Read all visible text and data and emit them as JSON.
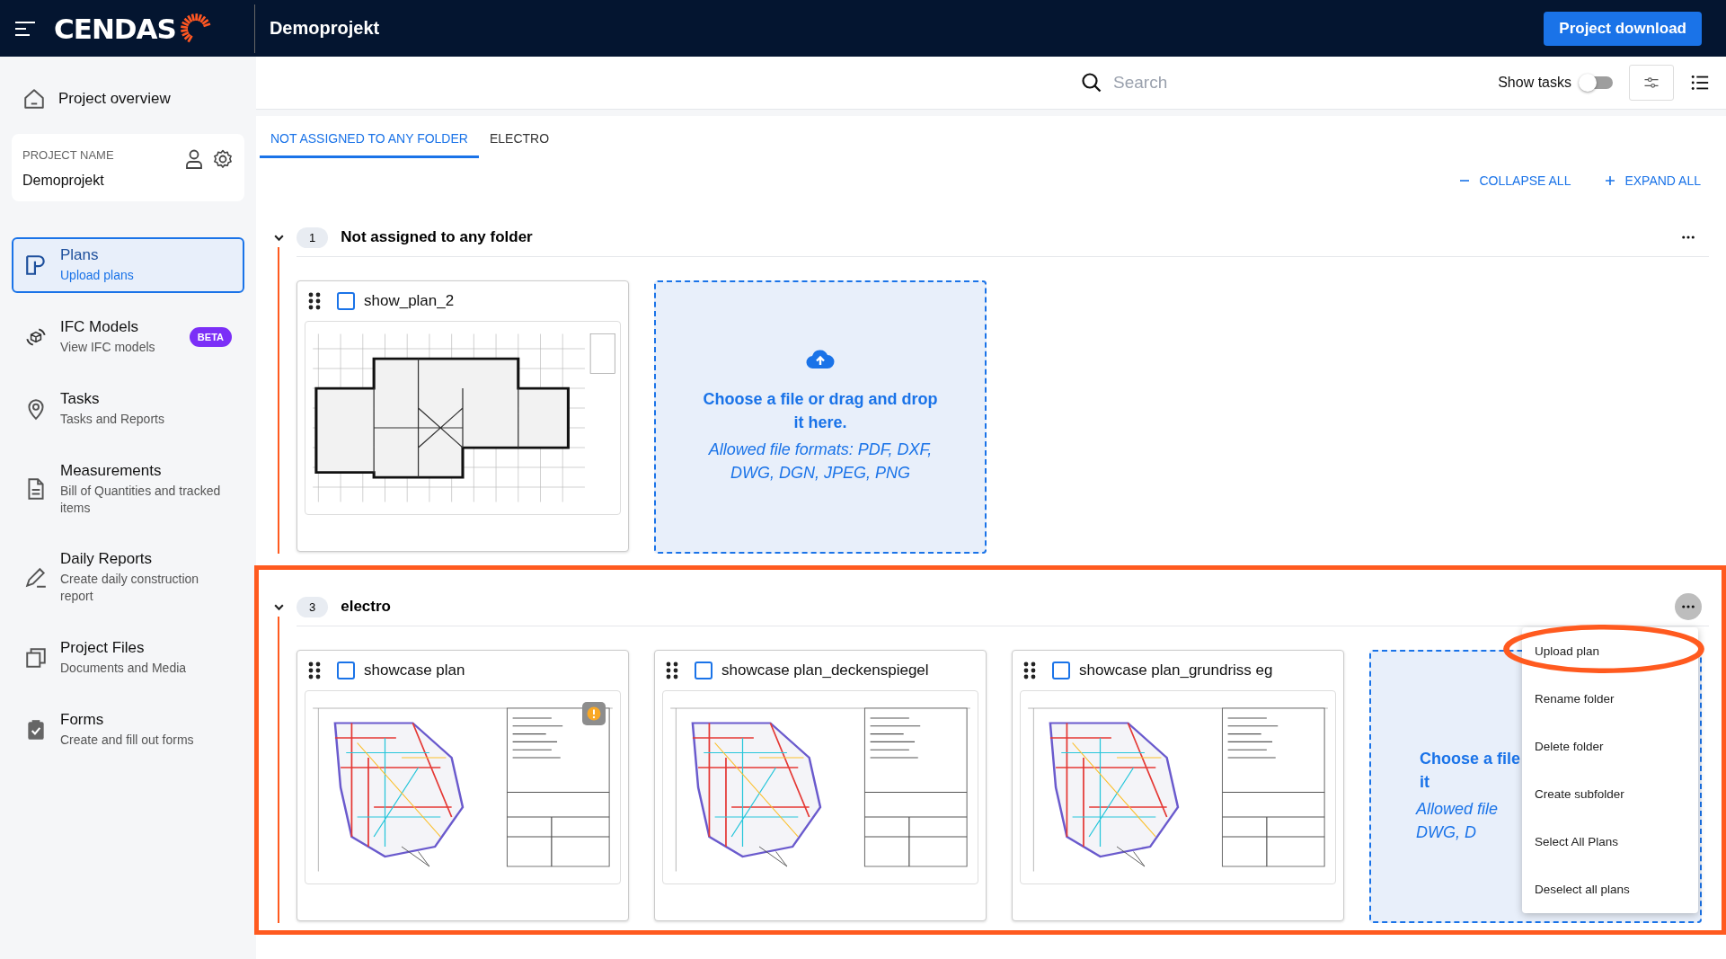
{
  "topbar": {
    "logo": "CENDAS",
    "project": "Demoprojekt",
    "download_button": "Project download"
  },
  "sidebar": {
    "overview": "Project overview",
    "project_card": {
      "label": "PROJECT NAME",
      "name": "Demoprojekt"
    },
    "items": [
      {
        "kind": "plans",
        "title": "Plans",
        "subtitle": "Upload plans",
        "selected": true
      },
      {
        "kind": "ifc",
        "title": "IFC Models",
        "subtitle": "View IFC models",
        "badge": "BETA",
        "selected": false
      },
      {
        "kind": "tasks",
        "title": "Tasks",
        "subtitle": "Tasks and Reports",
        "selected": false
      },
      {
        "kind": "measurements",
        "title": "Measurements",
        "subtitle": "Bill of Quantities and tracked items",
        "selected": false
      },
      {
        "kind": "daily",
        "title": "Daily Reports",
        "subtitle": "Create daily construction report",
        "selected": false
      },
      {
        "kind": "files",
        "title": "Project Files",
        "subtitle": "Documents and Media",
        "selected": false
      },
      {
        "kind": "forms",
        "title": "Forms",
        "subtitle": "Create and fill out forms",
        "selected": false
      }
    ]
  },
  "toolbar": {
    "search": {
      "placeholder": "Search"
    },
    "show_tasks": {
      "label": "Show tasks",
      "on": false
    }
  },
  "tabs": [
    {
      "label": "NOT ASSIGNED TO ANY FOLDER",
      "selected": true
    },
    {
      "label": "ELECTRO",
      "selected": false
    }
  ],
  "actions": [
    {
      "kind": "collapse",
      "label": "COLLAPSE ALL"
    },
    {
      "kind": "expand",
      "label": "EXPAND ALL"
    }
  ],
  "folders": [
    {
      "count": "1",
      "name": "Not assigned to any folder",
      "expanded": true,
      "highlighted": false,
      "menu_open": false,
      "plans": [
        {
          "name": "show_plan_2",
          "checked": false,
          "warning": false,
          "kind": "grid"
        }
      ],
      "dropzone": {
        "covered": false,
        "title_lines": [
          "Choose a file or drag and drop",
          "it here."
        ],
        "hint_lines": [
          "Allowed file formats: PDF, DXF,",
          "DWG, DGN, JPEG, PNG"
        ]
      }
    },
    {
      "count": "3",
      "name": "electro",
      "expanded": true,
      "highlighted": true,
      "menu_open": true,
      "plans": [
        {
          "name": "showcase plan",
          "checked": false,
          "warning": true,
          "kind": "round"
        },
        {
          "name": "showcase plan_deckenspiegel",
          "checked": false,
          "warning": false,
          "kind": "round"
        },
        {
          "name": "showcase plan_grundriss eg",
          "checked": false,
          "warning": false,
          "kind": "round"
        }
      ],
      "dropzone": {
        "covered": true,
        "title_lines": [
          "Choose a file",
          "it"
        ],
        "hint_lines": [
          "Allowed file",
          "DWG, D"
        ]
      },
      "menu": [
        {
          "label": "Upload plan",
          "circled": true
        },
        {
          "label": "Rename folder",
          "circled": false
        },
        {
          "label": "Delete folder",
          "circled": false
        },
        {
          "label": "Create subfolder",
          "circled": false
        },
        {
          "label": "Select All Plans",
          "circled": false
        },
        {
          "label": "Deselect all plans",
          "circled": false
        }
      ]
    }
  ]
}
